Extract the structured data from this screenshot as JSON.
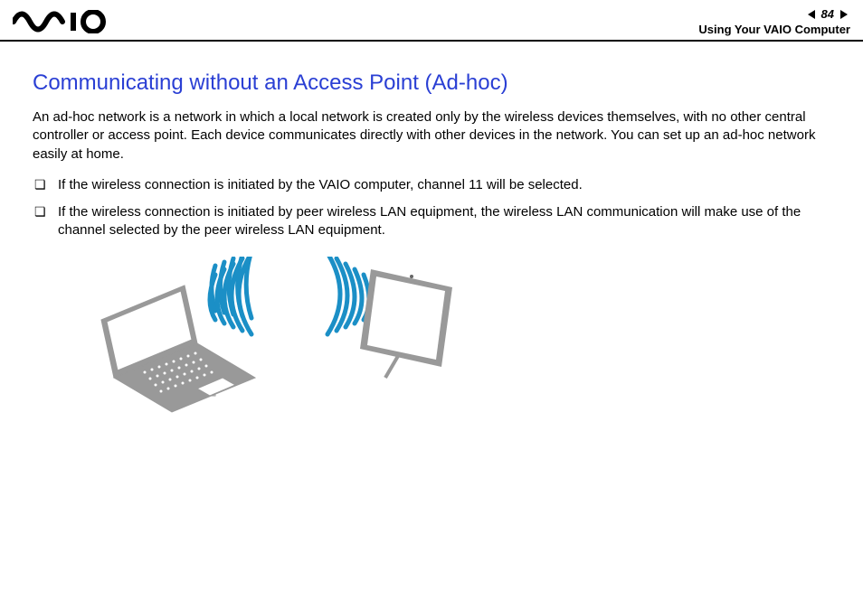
{
  "header": {
    "logo_name": "vaio-logo",
    "page_number": "84",
    "section": "Using Your VAIO Computer"
  },
  "content": {
    "heading": "Communicating without an Access Point (Ad-hoc)",
    "paragraph": "An ad-hoc network is a network in which a local network is created only by the wireless devices themselves, with no other central controller or access point. Each device communicates directly with other devices in the network. You can set up an ad-hoc network easily at home.",
    "bullets": [
      "If the wireless connection is initiated by the VAIO computer, channel 11 will be selected.",
      "If the wireless connection is initiated by peer wireless LAN equipment, the wireless LAN communication will make use of the channel selected by the peer wireless LAN equipment."
    ]
  },
  "illustration": {
    "description": "adhoc-wireless-diagram",
    "color_wave": "#1b8fc6",
    "color_device": "#999999"
  }
}
